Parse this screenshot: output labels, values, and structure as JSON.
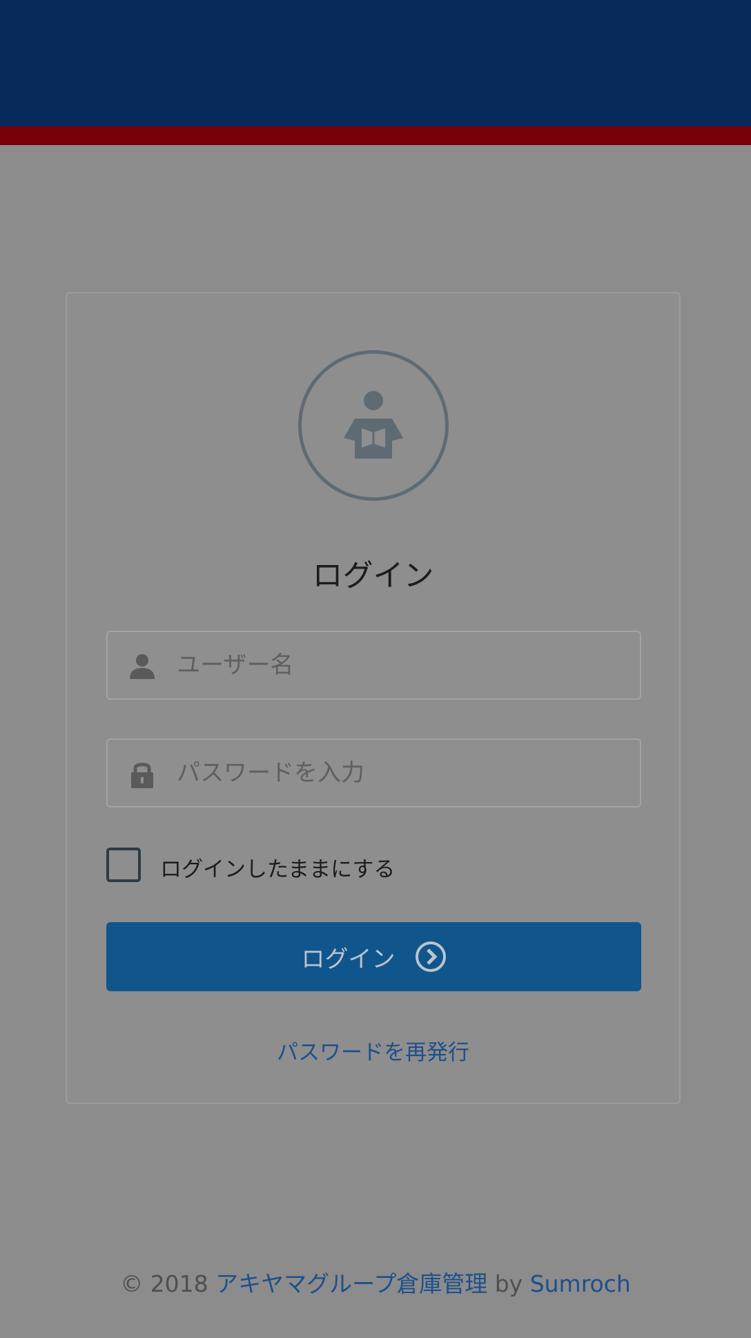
{
  "brand": {
    "header_color": "#072a5b",
    "stripe_color": "#7a0008",
    "accent": "#11558d"
  },
  "login": {
    "avatar_icon": "reader-icon",
    "title": "ログイン",
    "username": {
      "icon": "user-icon",
      "placeholder": "ユーザー名",
      "value": ""
    },
    "password": {
      "icon": "lock-icon",
      "placeholder": "パスワードを入力",
      "value": ""
    },
    "remember": {
      "label": "ログインしたままにする",
      "checked": false
    },
    "submit": {
      "label": "ログイン",
      "icon": "chevron-right-circle-icon"
    },
    "reset_link": "パスワードを再発行"
  },
  "footer": {
    "copyright": "© 2018",
    "app_name": "アキヤマグループ倉庫管理",
    "by": "by",
    "vendor": "Sumroch"
  }
}
